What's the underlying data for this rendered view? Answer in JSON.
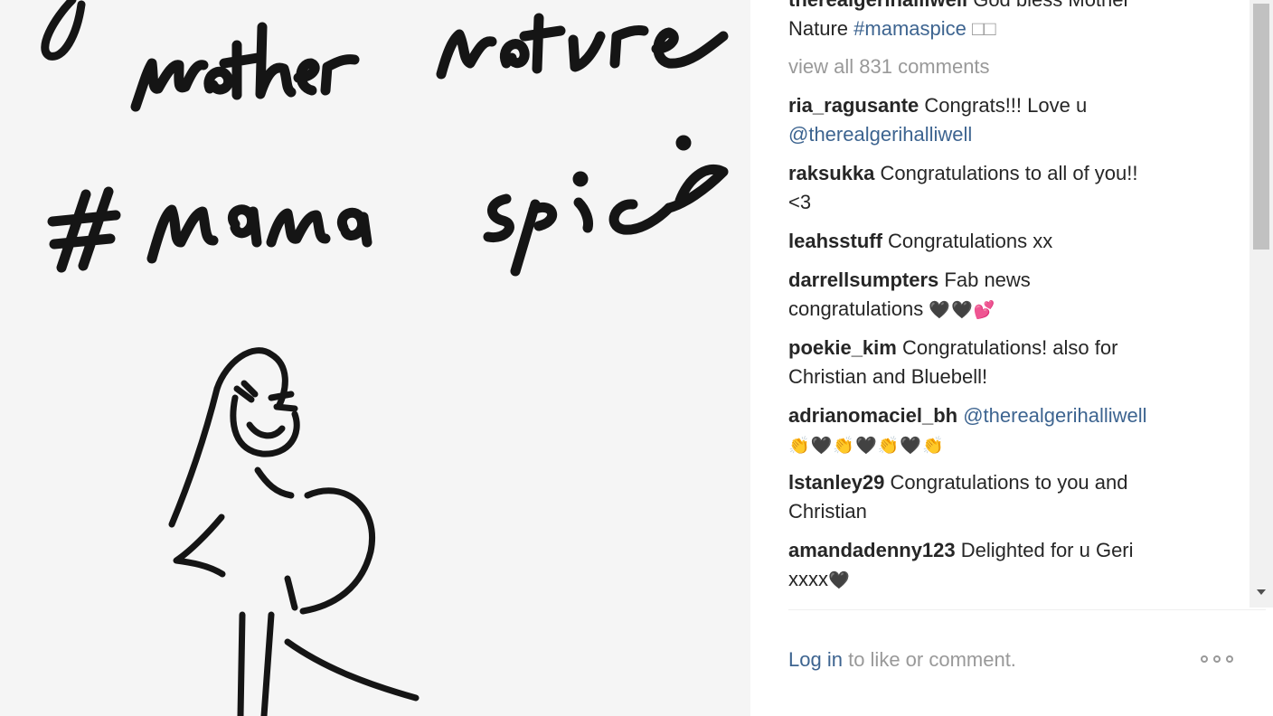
{
  "caption": {
    "username": "therealgerihalliwell",
    "text_1": "God bless Mother",
    "text_2": "Nature",
    "hashtag": "#mamaspice",
    "trailing": "□□"
  },
  "view_all_comments": "view all 831 comments",
  "comments": [
    {
      "user": "ria_ragusante",
      "text": "Congrats!!! Love u",
      "mention": "@therealgerihalliwell"
    },
    {
      "user": "raksukka",
      "text": "Congratulations to all of you!!",
      "text_2": "<3"
    },
    {
      "user": "leahsstuff",
      "text": "Congratulations xx"
    },
    {
      "user": "darrellsumpters",
      "text": "Fab news",
      "text_2": "congratulations",
      "emoji": "🖤🖤💕"
    },
    {
      "user": "poekie_kim",
      "text": "Congratulations! also for",
      "text_2": "Christian and Bluebell!"
    },
    {
      "user": "adrianomaciel_bh",
      "mention": "@therealgerihalliwell",
      "emoji": "👏🖤👏🖤👏🖤👏"
    },
    {
      "user": "lstanley29",
      "text": "Congratulations to you and",
      "text_2": "Christian"
    },
    {
      "user": "amandadenny123",
      "text": "Delighted for u Geri",
      "text_2": "xxxx",
      "emoji": "🖤"
    }
  ],
  "footer": {
    "login_label": "Log in",
    "rest": "to like or comment."
  },
  "photo": {
    "handwriting_1": "mother nature",
    "handwriting_2": "# mama spice"
  },
  "colors": {
    "link": "#3d6490",
    "username": "#262626",
    "muted": "#999999"
  },
  "icons": {
    "more": "more-options-icon",
    "scroll_down": "scroll-down-arrow-icon"
  }
}
